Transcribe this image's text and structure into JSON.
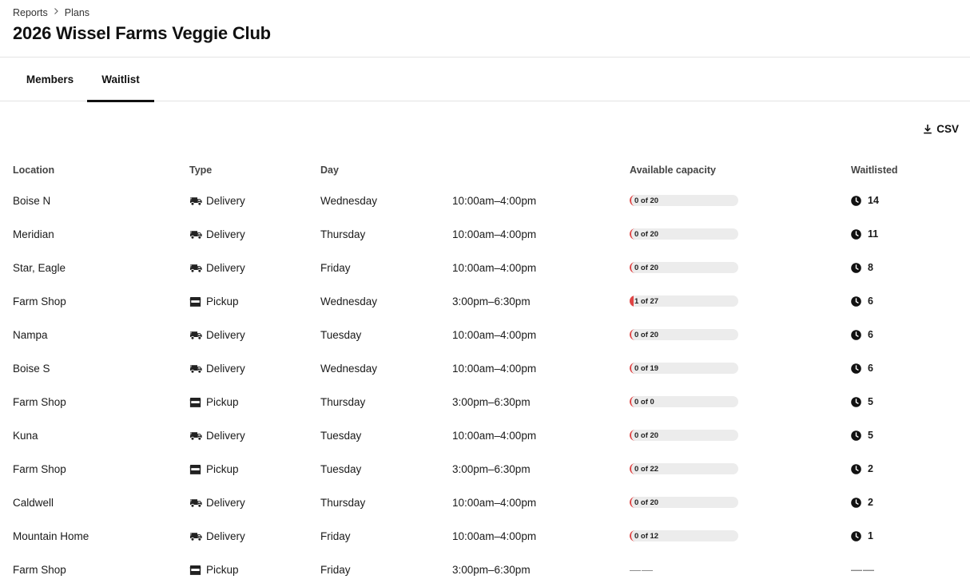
{
  "breadcrumb": {
    "items": [
      "Reports",
      "Plans"
    ]
  },
  "page_title": "2026 Wissel Farms Veggie Club",
  "tabs": [
    {
      "label": "Members",
      "active": false
    },
    {
      "label": "Waitlist",
      "active": true
    }
  ],
  "csv_button": {
    "label": "CSV",
    "icon": "download-icon"
  },
  "table": {
    "headers": {
      "location": "Location",
      "type": "Type",
      "day": "Day",
      "time": "",
      "capacity": "Available capacity",
      "waitlisted": "Waitlisted"
    },
    "rows": [
      {
        "location": "Boise N",
        "type": "Delivery",
        "type_icon": "truck-icon",
        "day": "Wednesday",
        "time": "10:00am–4:00pm",
        "capacity": "0 of 20",
        "capacity_filled": 0,
        "capacity_total": 20,
        "waitlisted": "14"
      },
      {
        "location": "Meridian",
        "type": "Delivery",
        "type_icon": "truck-icon",
        "day": "Thursday",
        "time": "10:00am–4:00pm",
        "capacity": "0 of 20",
        "capacity_filled": 0,
        "capacity_total": 20,
        "waitlisted": "11"
      },
      {
        "location": "Star, Eagle",
        "type": "Delivery",
        "type_icon": "truck-icon",
        "day": "Friday",
        "time": "10:00am–4:00pm",
        "capacity": "0 of 20",
        "capacity_filled": 0,
        "capacity_total": 20,
        "waitlisted": "8"
      },
      {
        "location": "Farm Shop",
        "type": "Pickup",
        "type_icon": "storefront-icon",
        "day": "Wednesday",
        "time": "3:00pm–6:30pm",
        "capacity": "1 of 27",
        "capacity_filled": 1,
        "capacity_total": 27,
        "waitlisted": "6"
      },
      {
        "location": "Nampa",
        "type": "Delivery",
        "type_icon": "truck-icon",
        "day": "Tuesday",
        "time": "10:00am–4:00pm",
        "capacity": "0 of 20",
        "capacity_filled": 0,
        "capacity_total": 20,
        "waitlisted": "6"
      },
      {
        "location": "Boise S",
        "type": "Delivery",
        "type_icon": "truck-icon",
        "day": "Wednesday",
        "time": "10:00am–4:00pm",
        "capacity": "0 of 19",
        "capacity_filled": 0,
        "capacity_total": 19,
        "waitlisted": "6"
      },
      {
        "location": "Farm Shop",
        "type": "Pickup",
        "type_icon": "storefront-icon",
        "day": "Thursday",
        "time": "3:00pm–6:30pm",
        "capacity": "0 of 0",
        "capacity_filled": 0,
        "capacity_total": 0,
        "waitlisted": "5"
      },
      {
        "location": "Kuna",
        "type": "Delivery",
        "type_icon": "truck-icon",
        "day": "Tuesday",
        "time": "10:00am–4:00pm",
        "capacity": "0 of 20",
        "capacity_filled": 0,
        "capacity_total": 20,
        "waitlisted": "5"
      },
      {
        "location": "Farm Shop",
        "type": "Pickup",
        "type_icon": "storefront-icon",
        "day": "Tuesday",
        "time": "3:00pm–6:30pm",
        "capacity": "0 of 22",
        "capacity_filled": 0,
        "capacity_total": 22,
        "waitlisted": "2"
      },
      {
        "location": "Caldwell",
        "type": "Delivery",
        "type_icon": "truck-icon",
        "day": "Thursday",
        "time": "10:00am–4:00pm",
        "capacity": "0 of 20",
        "capacity_filled": 0,
        "capacity_total": 20,
        "waitlisted": "2"
      },
      {
        "location": "Mountain Home",
        "type": "Delivery",
        "type_icon": "truck-icon",
        "day": "Friday",
        "time": "10:00am–4:00pm",
        "capacity": "0 of 12",
        "capacity_filled": 0,
        "capacity_total": 12,
        "waitlisted": "1"
      },
      {
        "location": "Farm Shop",
        "type": "Pickup",
        "type_icon": "storefront-icon",
        "day": "Friday",
        "time": "3:00pm–6:30pm",
        "capacity": "——",
        "capacity_filled": null,
        "capacity_total": null,
        "waitlisted": "——"
      }
    ]
  },
  "colors": {
    "capacity_fill": "#e04545",
    "capacity_track": "#ececec",
    "tab_indicator": "#111111"
  }
}
